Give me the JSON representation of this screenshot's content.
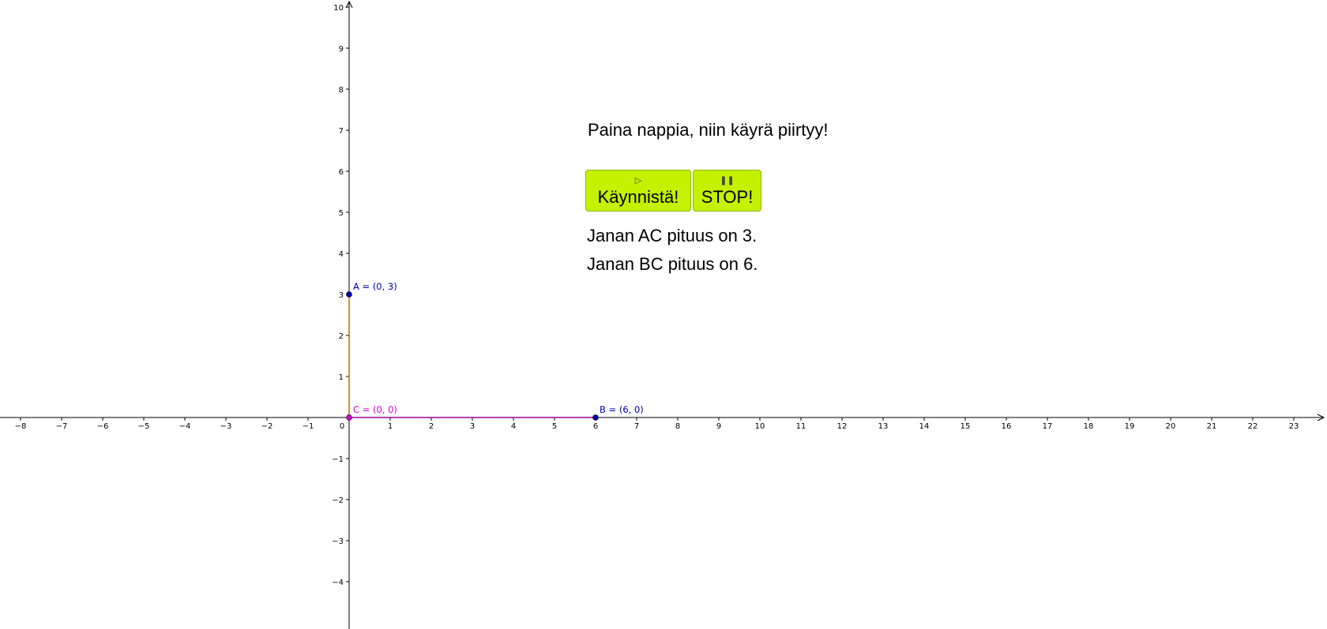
{
  "heading": "Paina nappia, niin käyrä piirtyy!",
  "buttons": {
    "start": {
      "icon": "play-icon",
      "label": "Käynnistä!"
    },
    "stop": {
      "icon": "pause-icon",
      "label": "STOP!"
    }
  },
  "info": {
    "ac": "Janan AC pituus on 3.",
    "bc": "Janan BC pituus on 6."
  },
  "axes": {
    "x_ticks": [
      -8,
      -7,
      -6,
      -5,
      -4,
      -3,
      -2,
      -1,
      0,
      1,
      2,
      3,
      4,
      5,
      6,
      7,
      8,
      9,
      10,
      11,
      12,
      13,
      14,
      15,
      16,
      17,
      18,
      19,
      20,
      21,
      22,
      23
    ],
    "y_ticks": [
      -4,
      -3,
      -2,
      -1,
      1,
      2,
      3,
      4,
      5,
      6,
      7,
      8,
      9,
      10
    ],
    "x_range": [
      -8.5,
      23.8
    ],
    "y_range": [
      -5,
      10.2
    ]
  },
  "points": [
    {
      "id": "A",
      "x": 0,
      "y": 3,
      "label": "A = (0, 3)",
      "color": "#0000aa"
    },
    {
      "id": "B",
      "x": 6,
      "y": 0,
      "label": "B = (6, 0)",
      "color": "#0000aa"
    },
    {
      "id": "C",
      "x": 0,
      "y": 0,
      "label": "C = (0, 0)",
      "color": "#cc00cc"
    }
  ],
  "segments": [
    {
      "from": "A",
      "to": "C",
      "color": "#cc6600"
    },
    {
      "from": "C",
      "to": "B",
      "color": "#990099"
    }
  ]
}
